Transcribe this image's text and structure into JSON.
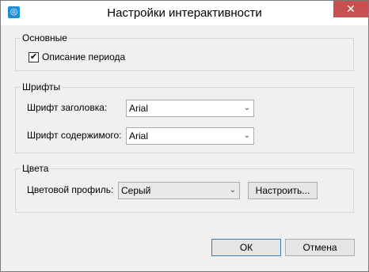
{
  "window": {
    "title": "Настройки интерактивности"
  },
  "groups": {
    "basic": {
      "legend": "Основные",
      "checkbox_label": "Описание периода",
      "checked": true
    },
    "fonts": {
      "legend": "Шрифты",
      "header_font_label": "Шрифт заголовка:",
      "header_font_value": "Arial",
      "content_font_label": "Шрифт содержимого:",
      "content_font_value": "Arial"
    },
    "colors": {
      "legend": "Цвета",
      "profile_label": "Цветовой профиль:",
      "profile_value": "Серый",
      "configure_button": "Настроить..."
    }
  },
  "buttons": {
    "ok": "ОК",
    "cancel": "Отмена"
  }
}
